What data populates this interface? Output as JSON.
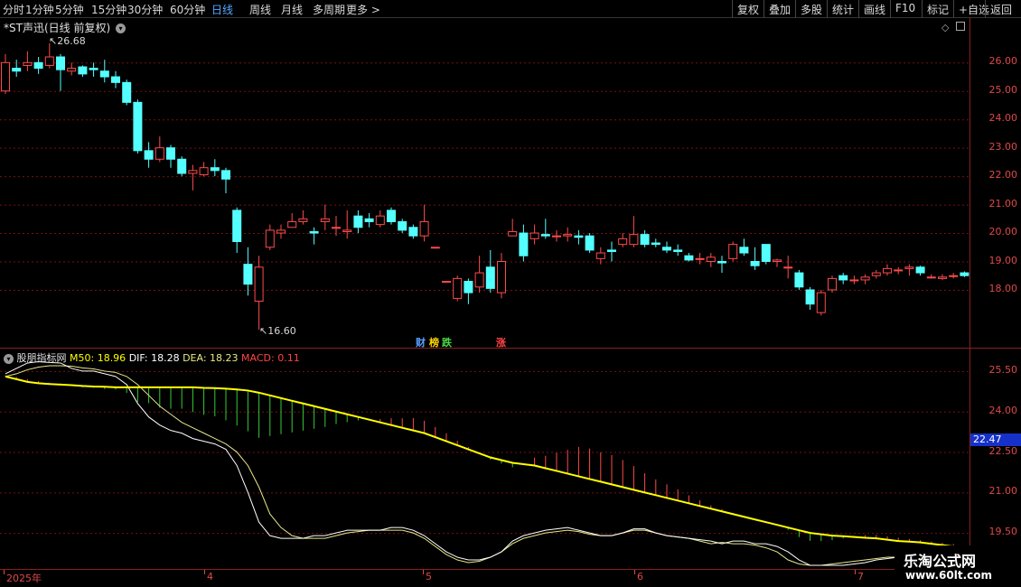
{
  "toolbar": {
    "timeframes": [
      "分时",
      "1分钟",
      "5分钟",
      "15分钟",
      "30分钟",
      "60分钟",
      "日线",
      "周线",
      "月线",
      "多周期",
      "更多 >"
    ],
    "active_timeframe": "日线",
    "buttons": [
      "复权",
      "叠加",
      "多股",
      "统计",
      "画线",
      "F10",
      "标记",
      "+自选",
      "返回"
    ]
  },
  "stock": {
    "title": "*ST声迅(日线 前复权)",
    "high_label": "26.68",
    "low_label": "16.60",
    "events": [
      {
        "text": "财",
        "color": "#5aa0ff"
      },
      {
        "text": "榜",
        "color": "#ffd700"
      },
      {
        "text": "跌",
        "color": "#44dd44"
      },
      {
        "text": "涨",
        "color": "#ff4444"
      }
    ]
  },
  "indicator": {
    "name": "股朋指标网",
    "m50_text": "M50: 18.96",
    "dif_text": "DIF: 18.28",
    "dea_text": "DEA: 18.23",
    "macd_text": "MACD: 0.11",
    "current_marker": "22.47"
  },
  "price_axis": [
    "26.00",
    "25.00",
    "24.00",
    "23.00",
    "22.00",
    "21.00",
    "20.00",
    "19.00",
    "18.00"
  ],
  "macd_axis": [
    "25.50",
    "24.00",
    "22.50",
    "21.00",
    "19.50"
  ],
  "date_axis": [
    "2025年",
    "4",
    "5",
    "6",
    "7"
  ],
  "watermark": {
    "title": "乐淘公式网",
    "url": "www.60lt.com"
  },
  "colors": {
    "up": "#ff4a4a",
    "down": "#54ffff",
    "m50": "#ffff00",
    "dif": "#ffffff",
    "dea": "#e8e888",
    "bar_up": "#ff4a4a",
    "bar_down": "#33cc33",
    "grid": "#7a1010"
  },
  "chart_data": {
    "type": "candlestick",
    "price_ylim": [
      16.6,
      26.9
    ],
    "candles": [
      [
        25.0,
        26.0,
        26.3,
        24.9
      ],
      [
        25.8,
        25.7,
        26.1,
        25.5
      ],
      [
        25.9,
        26.0,
        26.4,
        25.7
      ],
      [
        26.0,
        25.8,
        26.2,
        25.6
      ],
      [
        25.9,
        26.2,
        26.68,
        25.8
      ],
      [
        26.2,
        25.75,
        26.3,
        25.0
      ],
      [
        25.7,
        25.8,
        26.0,
        25.55
      ],
      [
        25.85,
        25.6,
        25.9,
        25.5
      ],
      [
        25.8,
        25.75,
        26.0,
        25.5
      ],
      [
        25.7,
        25.5,
        26.1,
        25.3
      ],
      [
        25.5,
        25.3,
        25.7,
        25.1
      ],
      [
        25.3,
        24.6,
        25.4,
        24.5
      ],
      [
        24.6,
        22.9,
        24.7,
        22.8
      ],
      [
        22.9,
        22.6,
        23.2,
        22.3
      ],
      [
        22.6,
        23.0,
        23.4,
        22.5
      ],
      [
        23.0,
        22.6,
        23.1,
        22.3
      ],
      [
        22.6,
        22.1,
        22.7,
        22.0
      ],
      [
        22.1,
        22.2,
        22.4,
        21.5
      ],
      [
        22.05,
        22.3,
        22.5,
        22.0
      ],
      [
        22.3,
        22.2,
        22.6,
        22.0
      ],
      [
        22.2,
        21.9,
        22.3,
        21.4
      ],
      [
        20.8,
        19.7,
        20.9,
        19.3
      ],
      [
        18.9,
        18.2,
        19.5,
        17.8
      ],
      [
        17.6,
        18.8,
        19.2,
        16.6
      ],
      [
        19.5,
        20.1,
        20.3,
        19.4
      ],
      [
        20.0,
        20.1,
        20.3,
        19.8
      ],
      [
        20.2,
        20.4,
        20.7,
        20.2
      ],
      [
        20.4,
        20.5,
        20.8,
        20.3
      ],
      [
        20.05,
        20.0,
        20.2,
        19.6
      ],
      [
        20.4,
        20.5,
        21.0,
        20.1
      ],
      [
        20.2,
        20.2,
        20.6,
        19.9
      ],
      [
        20.05,
        20.1,
        20.8,
        19.8
      ],
      [
        20.6,
        20.2,
        20.8,
        20.0
      ],
      [
        20.5,
        20.4,
        20.7,
        20.2
      ],
      [
        20.3,
        20.6,
        20.8,
        20.2
      ],
      [
        20.8,
        20.4,
        20.9,
        20.3
      ],
      [
        20.4,
        20.1,
        20.5,
        20.0
      ],
      [
        20.2,
        19.9,
        20.3,
        19.8
      ],
      [
        19.9,
        20.4,
        21.0,
        19.7
      ],
      [
        19.5,
        19.5,
        19.5,
        19.5
      ],
      [
        18.3,
        18.3,
        18.3,
        18.3
      ],
      [
        17.7,
        18.4,
        18.5,
        17.6
      ],
      [
        18.3,
        17.9,
        18.4,
        17.5
      ],
      [
        18.1,
        18.6,
        19.2,
        17.9
      ],
      [
        18.8,
        18.05,
        19.4,
        17.9
      ],
      [
        17.9,
        19.0,
        19.3,
        17.7
      ],
      [
        19.9,
        20.05,
        20.5,
        19.9
      ],
      [
        20.0,
        19.2,
        20.3,
        19.0
      ],
      [
        19.8,
        20.0,
        20.3,
        19.6
      ],
      [
        19.95,
        19.9,
        20.5,
        19.8
      ],
      [
        19.9,
        19.9,
        20.1,
        19.7
      ],
      [
        19.9,
        19.95,
        20.2,
        19.7
      ],
      [
        19.9,
        19.85,
        20.1,
        19.6
      ],
      [
        19.9,
        19.4,
        20.0,
        19.3
      ],
      [
        19.1,
        19.3,
        19.5,
        18.9
      ],
      [
        19.4,
        19.35,
        19.7,
        19.0
      ],
      [
        19.6,
        19.8,
        20.0,
        19.5
      ],
      [
        19.6,
        19.95,
        20.6,
        19.5
      ],
      [
        19.95,
        19.6,
        20.1,
        19.5
      ],
      [
        19.65,
        19.6,
        19.8,
        19.5
      ],
      [
        19.5,
        19.4,
        19.7,
        19.3
      ],
      [
        19.4,
        19.35,
        19.6,
        19.2
      ],
      [
        19.2,
        19.05,
        19.3,
        19.0
      ],
      [
        19.1,
        19.1,
        19.3,
        18.9
      ],
      [
        19.0,
        19.15,
        19.3,
        18.8
      ],
      [
        19.0,
        18.95,
        19.2,
        18.6
      ],
      [
        19.1,
        19.6,
        19.7,
        19.0
      ],
      [
        19.5,
        19.3,
        19.8,
        19.2
      ],
      [
        19.0,
        18.85,
        19.5,
        18.7
      ],
      [
        19.6,
        19.0,
        19.6,
        18.9
      ],
      [
        19.0,
        19.05,
        19.1,
        18.8
      ],
      [
        18.8,
        18.8,
        19.2,
        18.4
      ],
      [
        18.6,
        18.1,
        18.7,
        18.0
      ],
      [
        18.0,
        17.5,
        18.1,
        17.3
      ],
      [
        17.2,
        17.9,
        18.0,
        17.1
      ],
      [
        18.0,
        18.4,
        18.5,
        17.9
      ],
      [
        18.5,
        18.35,
        18.6,
        18.2
      ],
      [
        18.35,
        18.35,
        18.5,
        18.2
      ],
      [
        18.35,
        18.45,
        18.55,
        18.2
      ],
      [
        18.5,
        18.6,
        18.7,
        18.4
      ],
      [
        18.6,
        18.75,
        18.9,
        18.5
      ],
      [
        18.7,
        18.7,
        18.8,
        18.55
      ],
      [
        18.75,
        18.8,
        18.9,
        18.5
      ],
      [
        18.8,
        18.6,
        18.85,
        18.5
      ],
      [
        18.45,
        18.45,
        18.55,
        18.4
      ],
      [
        18.4,
        18.45,
        18.55,
        18.35
      ],
      [
        18.5,
        18.5,
        18.6,
        18.4
      ],
      [
        18.6,
        18.5,
        18.65,
        18.45
      ]
    ],
    "macd_ylim": [
      18.3,
      26.0
    ],
    "m50": [
      25.3,
      25.2,
      25.1,
      25.05,
      25.02,
      25.0,
      24.98,
      24.95,
      24.93,
      24.92,
      24.9,
      24.9,
      24.9,
      24.9,
      24.9,
      24.9,
      24.9,
      24.9,
      24.88,
      24.87,
      24.85,
      24.82,
      24.78,
      24.7,
      24.6,
      24.5,
      24.4,
      24.3,
      24.2,
      24.1,
      24.0,
      23.9,
      23.8,
      23.7,
      23.6,
      23.5,
      23.4,
      23.3,
      23.2,
      23.05,
      22.9,
      22.75,
      22.6,
      22.45,
      22.3,
      22.2,
      22.1,
      22.05,
      22.0,
      21.9,
      21.8,
      21.7,
      21.6,
      21.5,
      21.4,
      21.3,
      21.2,
      21.1,
      21.0,
      20.9,
      20.8,
      20.7,
      20.6,
      20.5,
      20.4,
      20.3,
      20.2,
      20.1,
      20.0,
      19.9,
      19.8,
      19.7,
      19.6,
      19.5,
      19.45,
      19.4,
      19.38,
      19.35,
      19.32,
      19.3,
      19.25,
      19.2,
      19.18,
      19.15,
      19.1,
      19.05,
      19.0,
      18.96
    ],
    "dif": [
      25.4,
      25.6,
      25.8,
      25.85,
      25.82,
      25.8,
      25.6,
      25.5,
      25.5,
      25.4,
      25.3,
      25.0,
      24.3,
      23.8,
      23.5,
      23.3,
      23.2,
      23.0,
      22.9,
      22.8,
      22.6,
      22.0,
      21.0,
      19.9,
      19.4,
      19.3,
      19.3,
      19.3,
      19.4,
      19.4,
      19.5,
      19.6,
      19.6,
      19.6,
      19.6,
      19.7,
      19.7,
      19.6,
      19.4,
      19.1,
      18.8,
      18.6,
      18.5,
      18.5,
      18.6,
      18.8,
      19.2,
      19.4,
      19.5,
      19.6,
      19.65,
      19.7,
      19.6,
      19.5,
      19.4,
      19.4,
      19.5,
      19.65,
      19.65,
      19.5,
      19.4,
      19.35,
      19.3,
      19.25,
      19.2,
      19.1,
      19.2,
      19.2,
      19.1,
      19.1,
      19.0,
      18.8,
      18.5,
      18.3,
      18.3,
      18.3,
      18.3,
      18.35,
      18.4,
      18.5,
      18.55,
      18.6,
      18.7,
      18.6,
      18.5,
      18.45,
      18.4,
      18.28
    ],
    "dea": [
      25.3,
      25.4,
      25.55,
      25.65,
      25.7,
      25.7,
      25.68,
      25.62,
      25.58,
      25.5,
      25.45,
      25.3,
      25.0,
      24.6,
      24.2,
      23.9,
      23.6,
      23.4,
      23.2,
      23.0,
      22.8,
      22.5,
      22.0,
      21.2,
      20.2,
      19.7,
      19.4,
      19.3,
      19.3,
      19.3,
      19.4,
      19.5,
      19.55,
      19.6,
      19.6,
      19.6,
      19.6,
      19.5,
      19.3,
      19.0,
      18.7,
      18.5,
      18.4,
      18.45,
      18.6,
      18.8,
      19.1,
      19.3,
      19.4,
      19.5,
      19.55,
      19.6,
      19.55,
      19.45,
      19.4,
      19.4,
      19.5,
      19.6,
      19.6,
      19.5,
      19.4,
      19.35,
      19.3,
      19.2,
      19.1,
      19.15,
      19.1,
      19.1,
      19.05,
      18.95,
      18.8,
      18.5,
      18.35,
      18.3,
      18.3,
      18.35,
      18.4,
      18.45,
      18.5,
      18.55,
      18.6,
      18.6,
      18.55,
      18.5,
      18.45,
      18.4,
      18.23
    ],
    "macd_bars": [
      0.05,
      0.1,
      0.12,
      0.1,
      0.06,
      0.05,
      -0.04,
      -0.06,
      -0.06,
      -0.1,
      -0.1,
      -0.25,
      -0.65,
      -0.7,
      -0.9,
      -0.95,
      -0.95,
      -1.1,
      -1.2,
      -1.25,
      -1.4,
      -1.6,
      -1.8,
      -2.0,
      -1.8,
      -1.6,
      -1.4,
      -1.2,
      -1.0,
      -0.8,
      -0.55,
      -0.35,
      -0.15,
      0.02,
      0.15,
      0.3,
      0.42,
      0.55,
      0.55,
      0.45,
      0.35,
      0.2,
      0.1,
      0.0,
      -0.1,
      -0.15,
      -0.2,
      0.0,
      0.35,
      0.55,
      0.8,
      1.05,
      1.3,
      1.35,
      1.3,
      1.3,
      1.2,
      1.05,
      0.85,
      0.7,
      0.6,
      0.5,
      0.35,
      0.25,
      0.15,
      0.1,
      0.05,
      0.05,
      0.03,
      0.02,
      0.0,
      -0.1,
      -0.3,
      -0.35,
      -0.3,
      -0.2,
      -0.1,
      0.05,
      0.12,
      0.15,
      0.15,
      0.15,
      0.12,
      0.1,
      0.1,
      0.1,
      0.11
    ]
  }
}
